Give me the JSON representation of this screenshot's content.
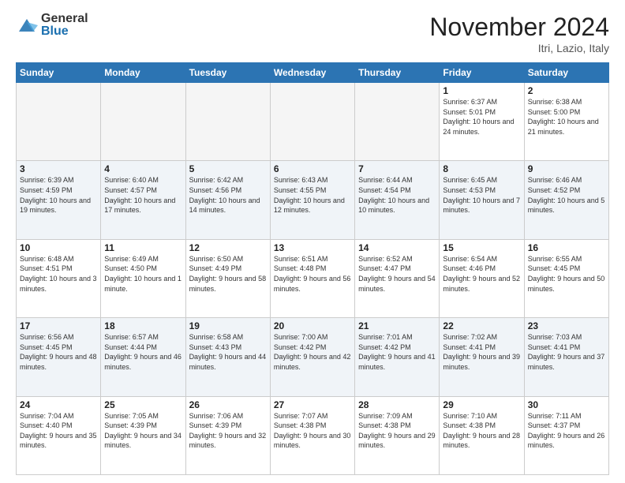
{
  "logo": {
    "general": "General",
    "blue": "Blue"
  },
  "header": {
    "month": "November 2024",
    "location": "Itri, Lazio, Italy"
  },
  "weekdays": [
    "Sunday",
    "Monday",
    "Tuesday",
    "Wednesday",
    "Thursday",
    "Friday",
    "Saturday"
  ],
  "weeks": [
    [
      {
        "day": "",
        "info": ""
      },
      {
        "day": "",
        "info": ""
      },
      {
        "day": "",
        "info": ""
      },
      {
        "day": "",
        "info": ""
      },
      {
        "day": "",
        "info": ""
      },
      {
        "day": "1",
        "info": "Sunrise: 6:37 AM\nSunset: 5:01 PM\nDaylight: 10 hours and 24 minutes."
      },
      {
        "day": "2",
        "info": "Sunrise: 6:38 AM\nSunset: 5:00 PM\nDaylight: 10 hours and 21 minutes."
      }
    ],
    [
      {
        "day": "3",
        "info": "Sunrise: 6:39 AM\nSunset: 4:59 PM\nDaylight: 10 hours and 19 minutes."
      },
      {
        "day": "4",
        "info": "Sunrise: 6:40 AM\nSunset: 4:57 PM\nDaylight: 10 hours and 17 minutes."
      },
      {
        "day": "5",
        "info": "Sunrise: 6:42 AM\nSunset: 4:56 PM\nDaylight: 10 hours and 14 minutes."
      },
      {
        "day": "6",
        "info": "Sunrise: 6:43 AM\nSunset: 4:55 PM\nDaylight: 10 hours and 12 minutes."
      },
      {
        "day": "7",
        "info": "Sunrise: 6:44 AM\nSunset: 4:54 PM\nDaylight: 10 hours and 10 minutes."
      },
      {
        "day": "8",
        "info": "Sunrise: 6:45 AM\nSunset: 4:53 PM\nDaylight: 10 hours and 7 minutes."
      },
      {
        "day": "9",
        "info": "Sunrise: 6:46 AM\nSunset: 4:52 PM\nDaylight: 10 hours and 5 minutes."
      }
    ],
    [
      {
        "day": "10",
        "info": "Sunrise: 6:48 AM\nSunset: 4:51 PM\nDaylight: 10 hours and 3 minutes."
      },
      {
        "day": "11",
        "info": "Sunrise: 6:49 AM\nSunset: 4:50 PM\nDaylight: 10 hours and 1 minute."
      },
      {
        "day": "12",
        "info": "Sunrise: 6:50 AM\nSunset: 4:49 PM\nDaylight: 9 hours and 58 minutes."
      },
      {
        "day": "13",
        "info": "Sunrise: 6:51 AM\nSunset: 4:48 PM\nDaylight: 9 hours and 56 minutes."
      },
      {
        "day": "14",
        "info": "Sunrise: 6:52 AM\nSunset: 4:47 PM\nDaylight: 9 hours and 54 minutes."
      },
      {
        "day": "15",
        "info": "Sunrise: 6:54 AM\nSunset: 4:46 PM\nDaylight: 9 hours and 52 minutes."
      },
      {
        "day": "16",
        "info": "Sunrise: 6:55 AM\nSunset: 4:45 PM\nDaylight: 9 hours and 50 minutes."
      }
    ],
    [
      {
        "day": "17",
        "info": "Sunrise: 6:56 AM\nSunset: 4:45 PM\nDaylight: 9 hours and 48 minutes."
      },
      {
        "day": "18",
        "info": "Sunrise: 6:57 AM\nSunset: 4:44 PM\nDaylight: 9 hours and 46 minutes."
      },
      {
        "day": "19",
        "info": "Sunrise: 6:58 AM\nSunset: 4:43 PM\nDaylight: 9 hours and 44 minutes."
      },
      {
        "day": "20",
        "info": "Sunrise: 7:00 AM\nSunset: 4:42 PM\nDaylight: 9 hours and 42 minutes."
      },
      {
        "day": "21",
        "info": "Sunrise: 7:01 AM\nSunset: 4:42 PM\nDaylight: 9 hours and 41 minutes."
      },
      {
        "day": "22",
        "info": "Sunrise: 7:02 AM\nSunset: 4:41 PM\nDaylight: 9 hours and 39 minutes."
      },
      {
        "day": "23",
        "info": "Sunrise: 7:03 AM\nSunset: 4:41 PM\nDaylight: 9 hours and 37 minutes."
      }
    ],
    [
      {
        "day": "24",
        "info": "Sunrise: 7:04 AM\nSunset: 4:40 PM\nDaylight: 9 hours and 35 minutes."
      },
      {
        "day": "25",
        "info": "Sunrise: 7:05 AM\nSunset: 4:39 PM\nDaylight: 9 hours and 34 minutes."
      },
      {
        "day": "26",
        "info": "Sunrise: 7:06 AM\nSunset: 4:39 PM\nDaylight: 9 hours and 32 minutes."
      },
      {
        "day": "27",
        "info": "Sunrise: 7:07 AM\nSunset: 4:38 PM\nDaylight: 9 hours and 30 minutes."
      },
      {
        "day": "28",
        "info": "Sunrise: 7:09 AM\nSunset: 4:38 PM\nDaylight: 9 hours and 29 minutes."
      },
      {
        "day": "29",
        "info": "Sunrise: 7:10 AM\nSunset: 4:38 PM\nDaylight: 9 hours and 28 minutes."
      },
      {
        "day": "30",
        "info": "Sunrise: 7:11 AM\nSunset: 4:37 PM\nDaylight: 9 hours and 26 minutes."
      }
    ]
  ]
}
